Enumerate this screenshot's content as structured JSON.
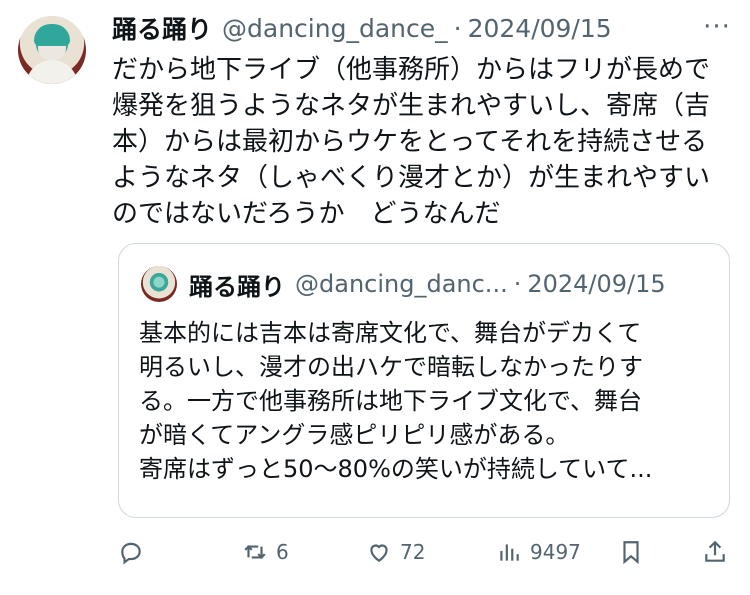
{
  "tweet": {
    "author_name": "踊る踊り",
    "handle": "@dancing_dance_",
    "separator": "·",
    "date": "2024/09/15",
    "more_label": "···",
    "text": "だから地下ライブ（他事務所）からはフリが長めで\n爆発を狙うようなネタが生まれやすいし、寄席（吉\n本）からは最初からウケをとってそれを持続させる\nようなネタ（しゃべくり漫才とか）が生まれやすい\nのではないだろうか　どうなんだ"
  },
  "quote": {
    "author_name": "踊る踊り",
    "handle": "@dancing_danc...",
    "separator": "·",
    "date": "2024/09/15",
    "text": "基本的には吉本は寄席文化で、舞台がデカくて\n明るいし、漫才の出ハケで暗転しなかったりす\nる。一方で他事務所は地下ライブ文化で、舞台\nが暗くてアングラ感ピリピリ感がある。\n寄席はずっと50〜80%の笑いが持続していて..."
  },
  "actions": {
    "reply_count": "",
    "retweet_count": "6",
    "like_count": "72",
    "views_count": "9497",
    "icons": [
      "reply-icon",
      "retweet-icon",
      "like-icon",
      "views-icon",
      "bookmark-icon",
      "share-icon"
    ]
  },
  "colors": {
    "text": "#0f1419",
    "secondary": "#536471",
    "border": "#cfd9de"
  }
}
